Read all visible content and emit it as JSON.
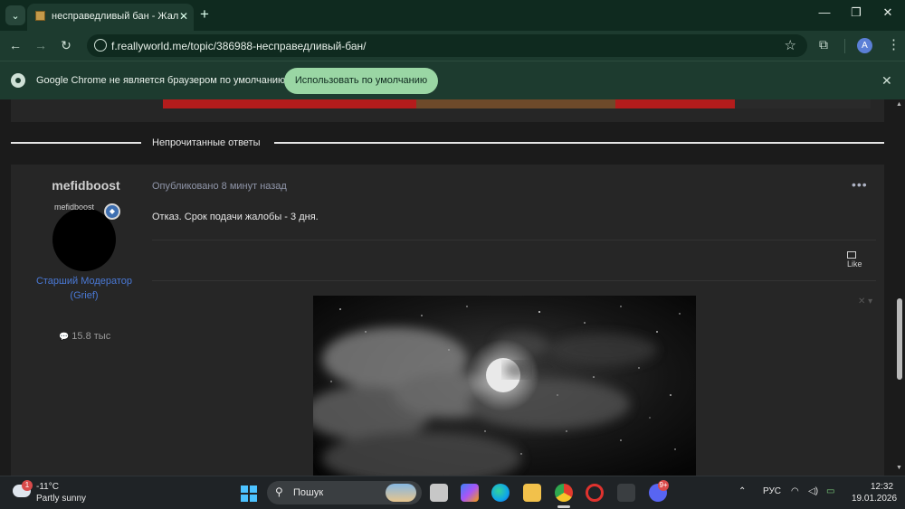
{
  "browser": {
    "tab_title": "несправедливый бан - Жалоб",
    "url": "f.reallyworld.me/topic/386988-несправедливый-бан/",
    "profile_initial": "A",
    "new_tab_symbol": "+",
    "icons": {
      "tab_search": "chevron-down-icon",
      "favicon": "reallyworld-favicon",
      "tab_close": "close-icon",
      "minimize": "minimize-icon",
      "restore": "restore-icon",
      "close": "close-icon",
      "back": "arrow-left-icon",
      "forward": "arrow-right-icon",
      "reload": "reload-icon",
      "site_info": "site-info-icon",
      "bookmark": "star-icon",
      "extensions": "puzzle-icon",
      "menu": "more-vertical-icon"
    }
  },
  "infobar": {
    "message": "Google Chrome не является браузером по умолчанию.",
    "button_label": "Использовать по умолчанию",
    "icon": "chrome-icon",
    "close_icon": "close-icon"
  },
  "forum": {
    "section_label": "Непрочитанные ответы",
    "post": {
      "author": "mefidboost",
      "avatar_alt": "mefidboost",
      "role_line1": "Старший Модератор",
      "role_line2": "(Grief)",
      "post_count": "15.8 тыс",
      "posted_label": "Опубликовано 8 минут назад",
      "content": "Отказ. Срок подачи жалобы - 3 дня.",
      "like_label": "Like",
      "more_symbol": "•••",
      "image_caption": "moon"
    }
  },
  "taskbar": {
    "temperature": "-11°C",
    "condition": "Partly sunny",
    "weather_badge": "1",
    "search_placeholder": "Пошук",
    "discord_badge": "9+",
    "language": "РУС",
    "time": "12:32",
    "date": "19.01.2026"
  }
}
